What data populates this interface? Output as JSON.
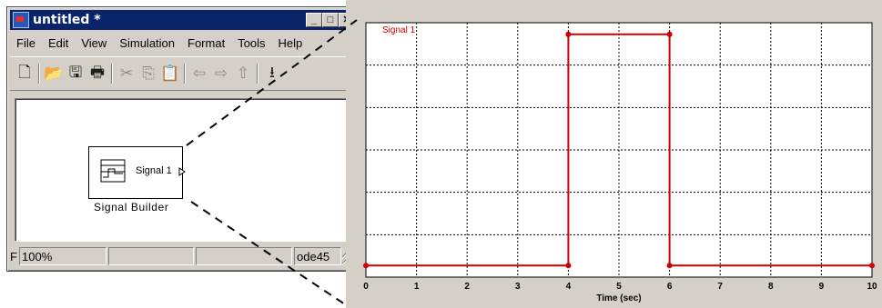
{
  "window": {
    "title": "untitled *",
    "minimize_glyph": "_",
    "maximize_glyph": "□",
    "close_glyph": "✕"
  },
  "menu": [
    "File",
    "Edit",
    "View",
    "Simulation",
    "Format",
    "Tools",
    "Help"
  ],
  "toolbar": [
    {
      "icon": "new-icon",
      "glyph": "🗋",
      "enabled": true
    },
    {
      "sep": true
    },
    {
      "icon": "open-icon",
      "glyph": "📂",
      "enabled": true
    },
    {
      "icon": "save-icon",
      "glyph": "🖫",
      "enabled": true
    },
    {
      "icon": "print-icon",
      "glyph": "🖶",
      "enabled": true
    },
    {
      "sep": true
    },
    {
      "icon": "cut-icon",
      "glyph": "✂",
      "enabled": false
    },
    {
      "icon": "copy-icon",
      "glyph": "⎘",
      "enabled": false
    },
    {
      "icon": "paste-icon",
      "glyph": "📋",
      "enabled": true
    },
    {
      "sep": true
    },
    {
      "icon": "back-icon",
      "glyph": "⇦",
      "enabled": false
    },
    {
      "icon": "forward-icon",
      "glyph": "⇨",
      "enabled": false
    },
    {
      "icon": "up-icon",
      "glyph": "⇧",
      "enabled": false
    },
    {
      "sep": true
    },
    {
      "icon": "step-icon",
      "glyph": "⭳",
      "enabled": true
    }
  ],
  "block": {
    "port_label": "Signal 1",
    "name": "Signal Builder"
  },
  "status": {
    "ready": "F",
    "zoom": "100%",
    "pane3": "",
    "pane4": "",
    "solver": "ode45"
  },
  "colors": {
    "signal": "#cc0000",
    "grid": "#000000",
    "titlebar": "#0a246a"
  },
  "chart_data": {
    "type": "line",
    "series": [
      {
        "name": "Signal 1",
        "x": [
          0,
          4,
          4,
          6,
          6,
          10
        ],
        "y": [
          0,
          0,
          1,
          1,
          0,
          0
        ]
      }
    ],
    "xlabel": "Time (sec)",
    "ylabel": "",
    "xticks": [
      "0",
      "1",
      "2",
      "3",
      "4",
      "5",
      "6",
      "7",
      "8",
      "9",
      "10"
    ],
    "xlim": [
      0,
      10
    ],
    "ylim": [
      -0.05,
      1.05
    ],
    "grid": true,
    "legend": "top-left"
  }
}
